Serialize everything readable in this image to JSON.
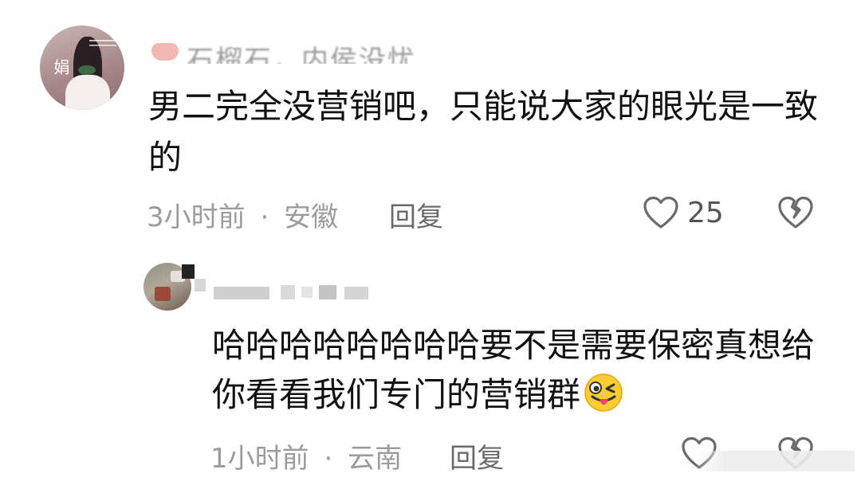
{
  "comment": {
    "username": "石榴石，内侯没忧",
    "text": "男二完全没营销吧，只能说大家的眼光是一致的",
    "time": "3小时前",
    "separator": "·",
    "location": "安徽",
    "reply_label": "回复",
    "like_count": "25",
    "avatar_glyph": "娟"
  },
  "reply": {
    "text": "哈哈哈哈哈哈哈哈要不是需要保密真想给你看看我们专门的营销群",
    "time": "1小时前",
    "separator": "·",
    "location": "云南",
    "reply_label": "回复",
    "emoji_icon": "winking-tongue-emoji"
  },
  "icons": {
    "like": "heart-outline-icon",
    "dislike": "broken-heart-icon"
  },
  "colors": {
    "text_primary": "#111111",
    "text_meta": "#9b9b9b",
    "icon": "#6a6a6a",
    "emoji_face": "#ffcc33",
    "emoji_tongue": "#ff3d6e"
  }
}
